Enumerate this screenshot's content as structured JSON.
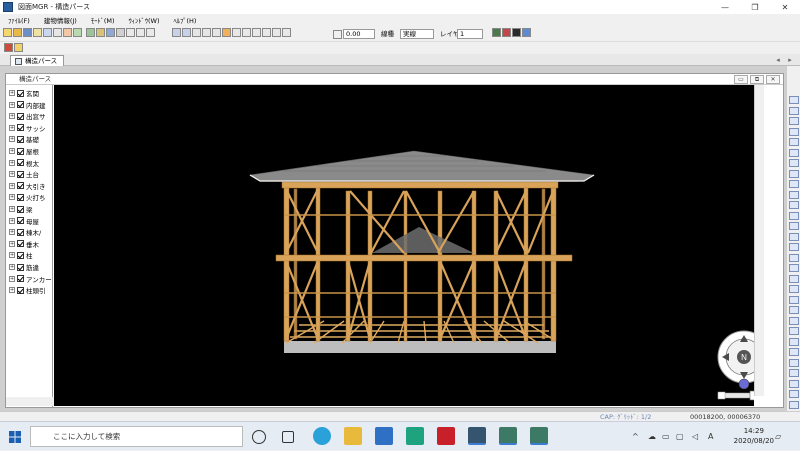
{
  "window": {
    "title": "図面MGR - 構造パース",
    "minimize": "—",
    "maximize": "❐",
    "close": "✕"
  },
  "menu": [
    "ﾌｧｲﾙ(F)",
    "建物情報(J)",
    "ﾓｰﾄﾞ(M)",
    "ｳｨﾝﾄﾞｳ(W)",
    "ﾍﾙﾌﾟ(H)"
  ],
  "toolbar": {
    "value_field": "0.00",
    "linetype_label": "線種",
    "linetype_value": "実線",
    "layer_label": "レイヤ",
    "layer_value": "1"
  },
  "tab": {
    "label": "構造パース",
    "scroll_left": "◂",
    "scroll_right": "▸"
  },
  "document": {
    "title": "構造パース",
    "min": "▭",
    "restore": "⧉",
    "close": "✕"
  },
  "tree": [
    "玄関",
    "内部建",
    "出窓サ",
    "サッシ",
    "基礎",
    "屋根",
    "根太",
    "土台",
    "大引き",
    "火打ち",
    "梁",
    "母屋",
    "棟木/",
    "垂木",
    "柱",
    "筋違",
    "アンカー",
    "柱頭引"
  ],
  "nav": {
    "north": "N",
    "zoom_in": "+",
    "zoom_out": "−"
  },
  "status": {
    "cap": "CAP: ｸﾞﾘｯﾄﾞ: 1/2",
    "coords": "00018200, 00006370"
  },
  "taskbar": {
    "search_placeholder": "ここに入力して検索",
    "time": "14:29",
    "date": "2020/08/20",
    "ime": "A",
    "chevron": "^"
  },
  "colors": {
    "timber": "#d9a35a",
    "roof": "#8a8a8a",
    "viewport": "#000000"
  }
}
